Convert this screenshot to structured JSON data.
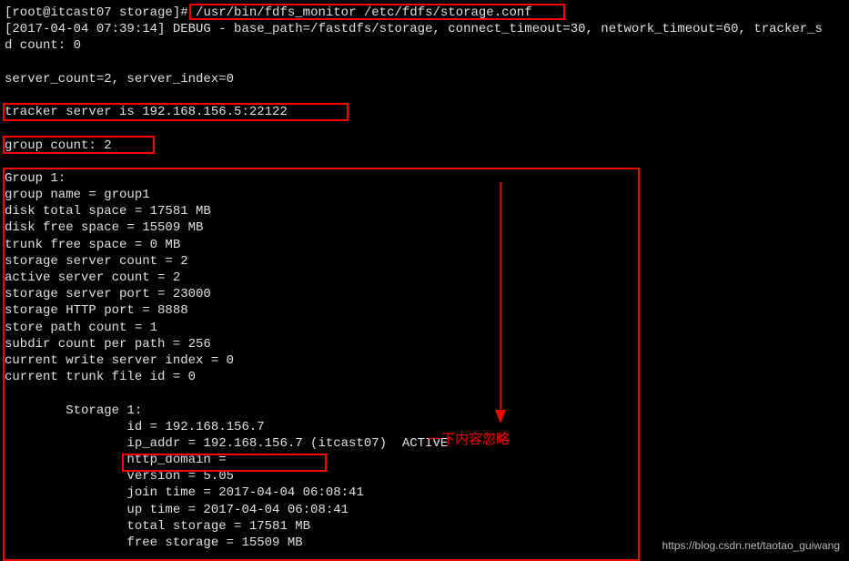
{
  "prompt": {
    "user_host": "[root@itcast07 storage]#",
    "command": "/usr/bin/fdfs_monitor /etc/fdfs/storage.conf"
  },
  "debug_line": "[2017-04-04 07:39:14] DEBUG - base_path=/fastdfs/storage, connect_timeout=30, network_timeout=60, tracker_s",
  "d_count": "d count: 0",
  "server_count": "server_count=2, server_index=0",
  "tracker_server": "tracker server is 192.168.156.5:22122",
  "group_count": "group count: 2",
  "group": {
    "header": "Group 1:",
    "name": "group name = group1",
    "disk_total": "disk total space = 17581 MB",
    "disk_free": "disk free space = 15509 MB",
    "trunk_free": "trunk free space = 0 MB",
    "storage_count": "storage server count = 2",
    "active_count": "active server count = 2",
    "storage_port": "storage server port = 23000",
    "http_port": "storage HTTP port = 8888",
    "store_path": "store path count = 1",
    "subdir": "subdir count per path = 256",
    "write_index": "current write server index = 0",
    "trunk_file": "current trunk file id = 0"
  },
  "storage": {
    "header": "        Storage 1:",
    "id": "                id = 192.168.156.7",
    "ip_addr": "                ip_addr = 192.168.156.7 (itcast07)  ACTIVE",
    "http_domain": "                http_domain =",
    "version": "                version = 5.05",
    "join_time": "                join time = 2017-04-04 06:08:41",
    "up_time": "                up time = 2017-04-04 06:08:41",
    "total_storage": "                total storage = 17581 MB",
    "free_storage": "                free storage = 15509 MB"
  },
  "annotation": "一下内容忽略",
  "watermark": "https://blog.csdn.net/taotao_guiwang"
}
